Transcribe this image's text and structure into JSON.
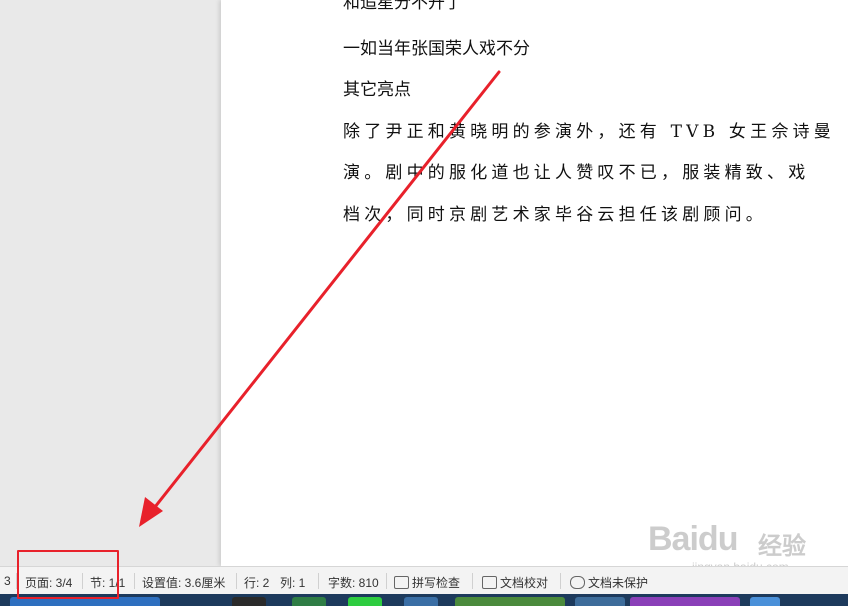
{
  "document": {
    "lines": [
      "和追星分不开了",
      "一如当年张国荣人戏不分",
      "其它亮点",
      "除了尹正和黄晓明的参演外，还有 TVB 女王佘诗曼",
      "演。剧中的服化道也让人赞叹不已，服装精致、戏",
      "档次，同时京剧艺术家毕谷云担任该剧顾问。"
    ]
  },
  "statusbar": {
    "page_num_prefix": "3",
    "page": "页面: 3/4",
    "section": "节: 1/1",
    "setting": "设置值: 3.6厘米",
    "row": "行: 2",
    "col": "列: 1",
    "word_count": "字数: 810",
    "spell_check": "拼写检查",
    "doc_compare": "文档校对",
    "doc_protect": "文档未保护"
  },
  "watermark": {
    "main": "Bai",
    "paw": "du",
    "cn": "经验",
    "url": "jingyan.baidu.com"
  },
  "colors": {
    "annotation_red": "#e8212b",
    "taskbar": "#1d3a5c"
  }
}
